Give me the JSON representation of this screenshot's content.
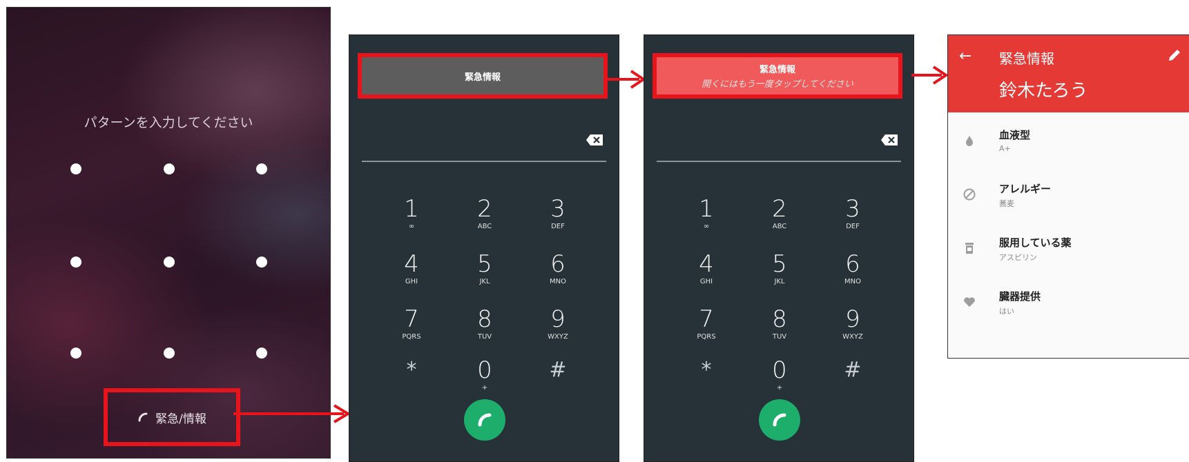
{
  "lock_screen": {
    "prompt": "パターンを入力してください",
    "emergency_label": "緊急/情報"
  },
  "dialer_first": {
    "banner_title": "緊急情報"
  },
  "dialer_second": {
    "banner_title": "緊急情報",
    "banner_sub": "開くにはもう一度タップしてください"
  },
  "keypad": [
    {
      "digit": "1",
      "letters": "∞"
    },
    {
      "digit": "2",
      "letters": "ABC"
    },
    {
      "digit": "3",
      "letters": "DEF"
    },
    {
      "digit": "4",
      "letters": "GHI"
    },
    {
      "digit": "5",
      "letters": "JKL"
    },
    {
      "digit": "6",
      "letters": "MNO"
    },
    {
      "digit": "7",
      "letters": "PQRS"
    },
    {
      "digit": "8",
      "letters": "TUV"
    },
    {
      "digit": "9",
      "letters": "WXYZ"
    },
    {
      "digit": "*",
      "letters": ""
    },
    {
      "digit": "0",
      "letters": "+"
    },
    {
      "digit": "#",
      "letters": ""
    }
  ],
  "info_screen": {
    "back_icon": "←",
    "title": "緊急情報",
    "name": "鈴木たろう",
    "rows": [
      {
        "label": "血液型",
        "value": "A+",
        "icon": "drop-icon"
      },
      {
        "label": "アレルギー",
        "value": "蕎麦",
        "icon": "block-icon"
      },
      {
        "label": "服用している薬",
        "value": "アスピリン",
        "icon": "pill-bottle-icon"
      },
      {
        "label": "臓器提供",
        "value": "はい",
        "icon": "heart-icon"
      }
    ]
  },
  "colors": {
    "highlight": "#e8141b",
    "dialer_bg": "#263237",
    "call_green": "#1dae6c",
    "info_header": "#e53935"
  }
}
